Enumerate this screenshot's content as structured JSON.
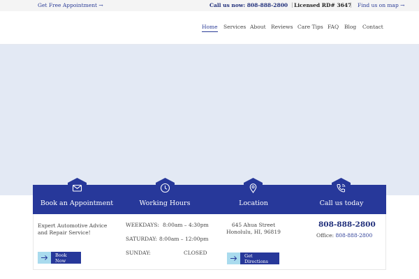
{
  "topbar": {
    "appointment_link": "Get Free Appointment →",
    "call_label": "Call us now: 808-888-2800",
    "separator": "|",
    "license": "Licensed RD# 3647",
    "map_link": "Find us on map →"
  },
  "nav": {
    "items": [
      "Home",
      "Services",
      "About",
      "Reviews",
      "Care Tips",
      "FAQ",
      "Blog",
      "Contact"
    ],
    "active": "Home"
  },
  "info": {
    "appointment": {
      "title": "Book an Appointment",
      "text": "Expert Automotive Advice and Repair Service!",
      "button": "Book Now"
    },
    "hours": {
      "title": "Working Hours",
      "rows": [
        {
          "day": "WEEKDAYS:",
          "time": "8:00am – 4:30pm"
        },
        {
          "day": "SATURDAY:",
          "time": "8:00am – 12:00pm"
        },
        {
          "day": "SUNDAY:",
          "time": "CLOSED"
        }
      ]
    },
    "location": {
      "title": "Location",
      "line1": "645 Ahua Street",
      "line2": "Honolulu, HI, 96819",
      "button": "Get Directions"
    },
    "call": {
      "title": "Call us today",
      "phone": "808-888-2800",
      "office_label": "Office:",
      "office_phone": "808-888-2800"
    }
  },
  "icons": {
    "appointment": "envelope-icon",
    "hours": "clock-icon",
    "location": "map-pin-icon",
    "call": "phone-icon",
    "button": "arrow-right-icon"
  },
  "colors": {
    "brand_blue": "#27389a",
    "hero_bg": "#e3e9f4",
    "button_icon_bg": "#a9dbee"
  }
}
